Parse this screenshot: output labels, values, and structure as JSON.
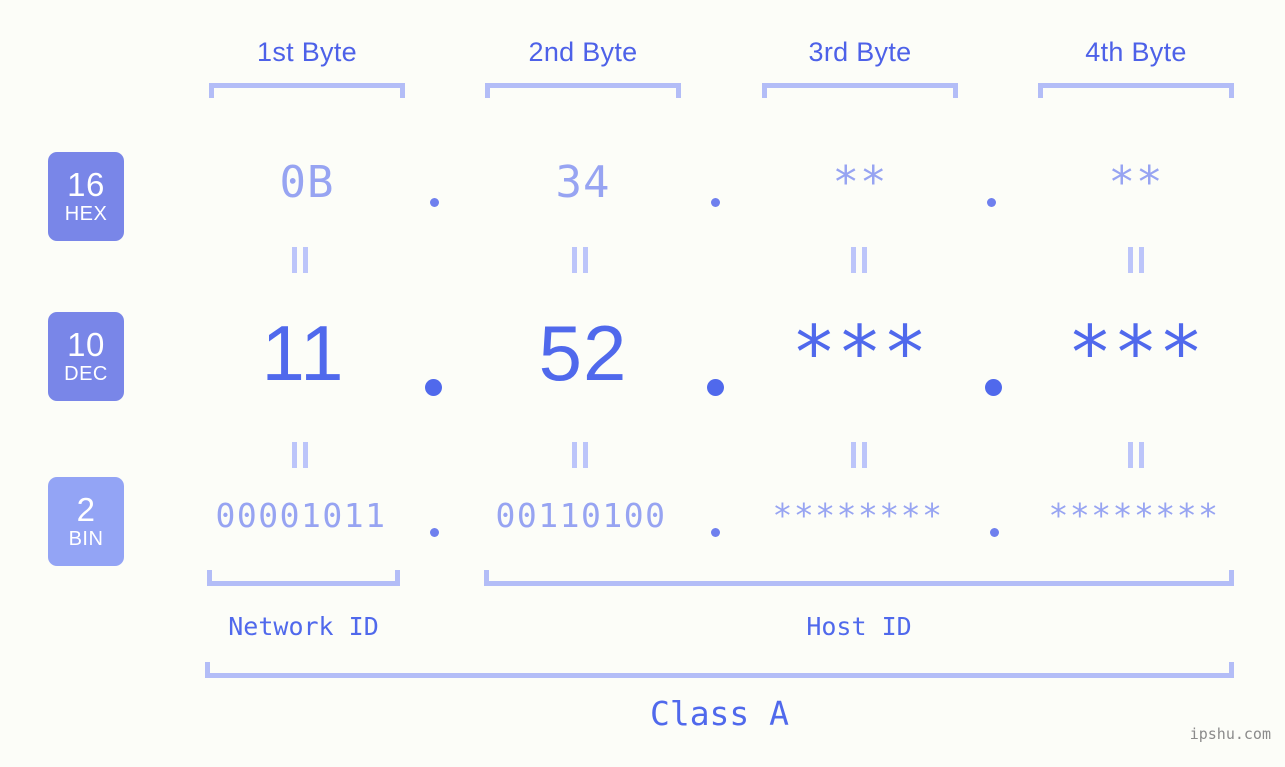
{
  "meta": {
    "watermark": "ipshu.com",
    "background_color": "#fcfdf8",
    "accent_dark": "#4d61e8",
    "accent_mid": "#5069ec",
    "accent_light": "#97a4f2",
    "bracket_color": "#b3bdf7",
    "badge_color": "#7986e8",
    "badge_color_light": "#93a4f5"
  },
  "headers": {
    "byte1": "1st Byte",
    "byte2": "2nd Byte",
    "byte3": "3rd Byte",
    "byte4": "4th Byte"
  },
  "badges": {
    "hex": {
      "radix": "16",
      "name": "HEX"
    },
    "dec": {
      "radix": "10",
      "name": "DEC"
    },
    "bin": {
      "radix": "2",
      "name": "BIN"
    }
  },
  "rows": {
    "hex": {
      "byte1": "0B",
      "byte2": "34",
      "byte3": "**",
      "byte4": "**",
      "sep1": ".",
      "sep2": ".",
      "sep3": "."
    },
    "dec": {
      "byte1": "11",
      "byte2": "52",
      "byte3": "***",
      "byte4": "***",
      "sep1": ".",
      "sep2": ".",
      "sep3": "."
    },
    "bin": {
      "byte1": "00001011",
      "byte2": "00110100",
      "byte3": "********",
      "byte4": "********",
      "sep1": ".",
      "sep2": ".",
      "sep3": "."
    }
  },
  "equals": {
    "hex_to_dec": "||",
    "dec_to_bin": "||"
  },
  "sections": {
    "network_id": "Network ID",
    "host_id": "Host ID",
    "class": "Class A"
  }
}
